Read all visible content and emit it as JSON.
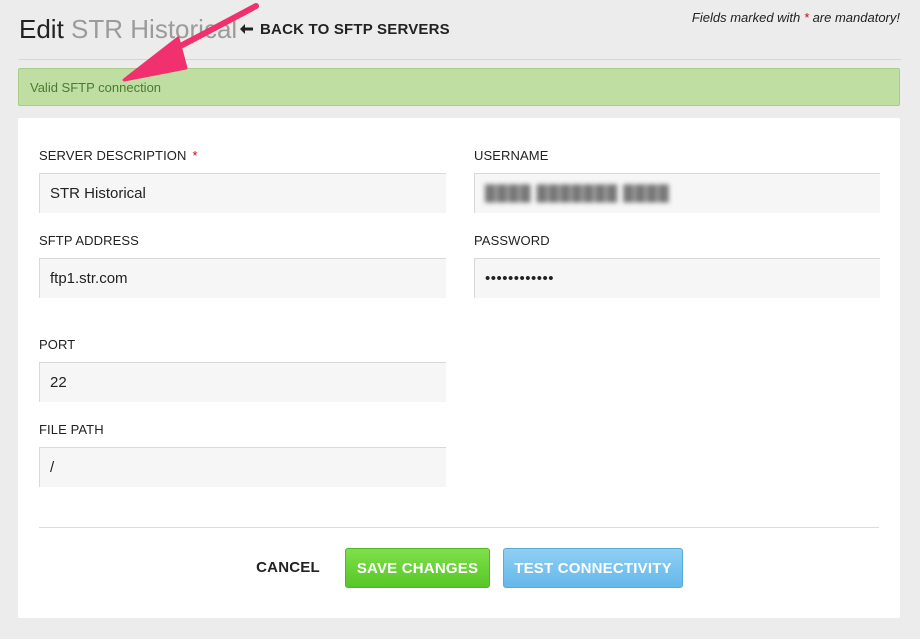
{
  "header": {
    "title_prefix": "Edit",
    "title_name": "STR Historical",
    "back_link": "BACK TO SFTP SERVERS",
    "mandatory_prefix": "Fields marked with ",
    "mandatory_star": "*",
    "mandatory_suffix": " are mandatory!"
  },
  "alert": {
    "message": "Valid SFTP connection",
    "color": "#bfdea2"
  },
  "form": {
    "server_description": {
      "label": "SERVER DESCRIPTION",
      "required_mark": "*",
      "value": "STR Historical"
    },
    "username": {
      "label": "USERNAME",
      "value": "████ ███████ ████"
    },
    "sftp_address": {
      "label": "SFTP ADDRESS",
      "value": "ftp1.str.com"
    },
    "password": {
      "label": "PASSWORD",
      "value": "••••••••••••"
    },
    "port": {
      "label": "PORT",
      "value": "22"
    },
    "file_path": {
      "label": "FILE PATH",
      "value": "/"
    }
  },
  "actions": {
    "cancel": "CANCEL",
    "save": "SAVE CHANGES",
    "test": "TEST CONNECTIVITY"
  },
  "colors": {
    "accent_annotation": "#f0306f",
    "save_button": "#5ec92f",
    "test_button": "#72bfec",
    "required": "#d0021b"
  }
}
